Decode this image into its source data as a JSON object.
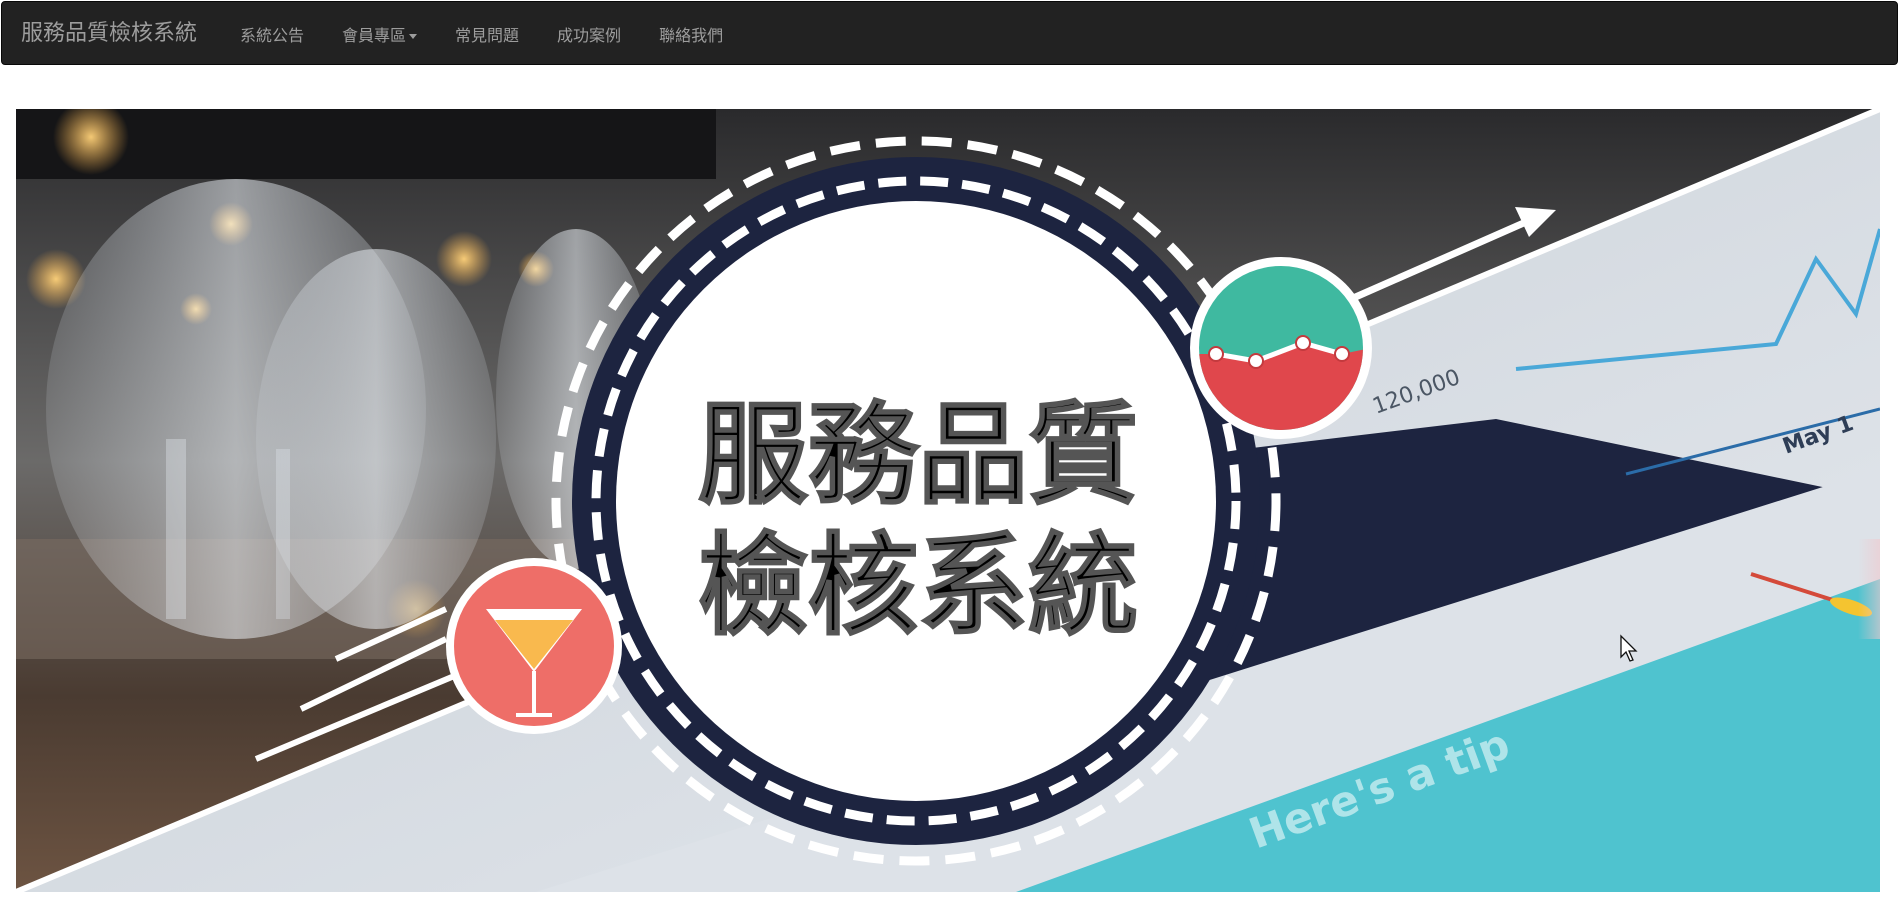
{
  "navbar": {
    "brand": "服務品質檢核系統",
    "items": [
      {
        "label": "系統公告",
        "dropdown": false
      },
      {
        "label": "會員專區",
        "dropdown": true
      },
      {
        "label": "常見問題",
        "dropdown": false
      },
      {
        "label": "成功案例",
        "dropdown": false
      },
      {
        "label": "聯絡我們",
        "dropdown": false
      }
    ]
  },
  "banner": {
    "title_line1": "服務品質",
    "title_line2": "檢核系統",
    "screen_axis_label": "120,000",
    "screen_date_label": "May 1",
    "screen_tip_text": "Here's a tip",
    "icons": [
      "cocktail-icon",
      "line-chart-icon",
      "arrow-icon"
    ],
    "colors": {
      "navbar_bg": "#222222",
      "nav_text": "#9d9d9d",
      "dark_navy": "#1d2440",
      "teal": "#3fb9a0",
      "red": "#e0474c",
      "coral": "#ee6e68",
      "gold": "#f9b94e",
      "cyan": "#4fc3cf"
    }
  }
}
